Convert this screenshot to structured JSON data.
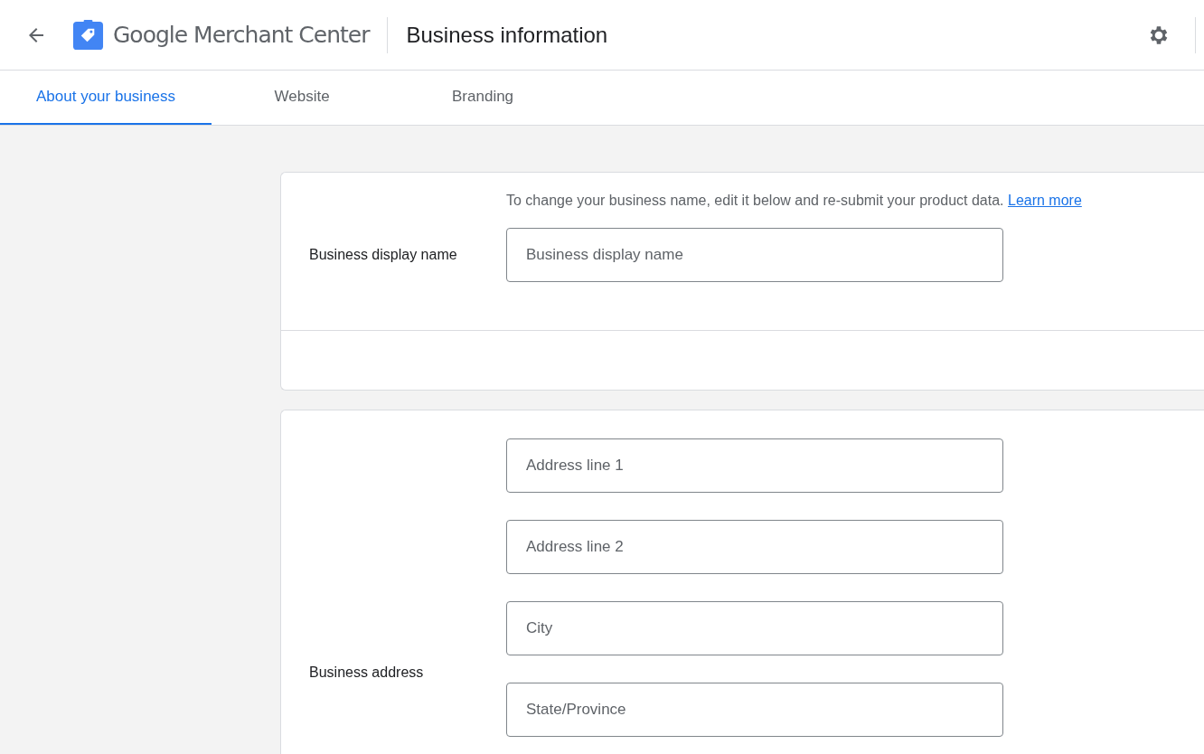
{
  "header": {
    "product_name": "Google Merchant Center",
    "page_title": "Business information"
  },
  "tabs": [
    {
      "label": "About your business",
      "selected": true
    },
    {
      "label": "Website",
      "selected": false
    },
    {
      "label": "Branding",
      "selected": false
    }
  ],
  "sections": [
    {
      "kind": "display_name",
      "label": "Business display name",
      "help_text": "To change your business name, edit it below and re-submit your product data.",
      "help_link": "Learn more",
      "fields": [
        {
          "placeholder": "Business display name"
        }
      ]
    },
    {
      "kind": "address",
      "label": "Business address",
      "fields": [
        {
          "placeholder": "Address line 1"
        },
        {
          "placeholder": "Address line 2"
        },
        {
          "placeholder": "City"
        },
        {
          "placeholder": "State/Province"
        }
      ]
    }
  ]
}
